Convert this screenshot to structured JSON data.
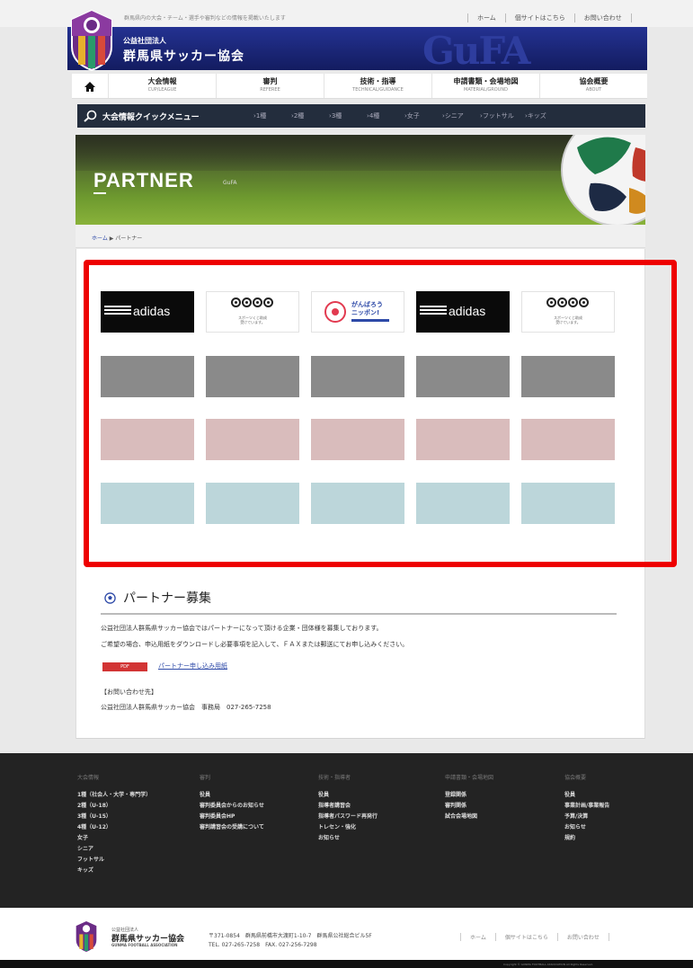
{
  "header": {
    "tagline": "群馬県内の大会・チーム・選手や審判などの情報を掲載いたします",
    "top_links": [
      "ホーム",
      "個サイトはこちら",
      "お問い合わせ"
    ],
    "assoc_sub": "公益社団法人",
    "assoc_title": "群馬県サッカー協会",
    "brand": "GuFA"
  },
  "nav": {
    "items": [
      {
        "label": "大会情報",
        "sub": "CUP/LEAGUE"
      },
      {
        "label": "審判",
        "sub": "REFEREE"
      },
      {
        "label": "技術・指導",
        "sub": "TECHNICAL/GUIDANCE"
      },
      {
        "label": "申請書類・会場地図",
        "sub": "MATERIAL/GROUND"
      },
      {
        "label": "協会概要",
        "sub": "ABOUT"
      }
    ]
  },
  "quick_menu": {
    "title": "大会情報クイックメニュー",
    "items": [
      "1種",
      "2種",
      "3種",
      "4種",
      "女子",
      "シニア",
      "フットサル",
      "キッズ"
    ]
  },
  "hero": {
    "title": "PARTNER",
    "sub": "GuFA"
  },
  "breadcrumb": {
    "home": "ホーム",
    "separator": " ▶ ",
    "current": "パートナー"
  },
  "partners": {
    "adidas_label": "adidas",
    "toto_caption": "スポーツくじ助成\n受けています。",
    "ganbaro_line1": "がんばろう",
    "ganbaro_line2": "ニッポン!",
    "colors": {
      "gray": "#8a8a8a",
      "pink": "#d9bcbc",
      "blue": "#bcd6da",
      "highlight": "#ee0000"
    }
  },
  "recruit": {
    "title": "パートナー募集",
    "p1": "公益社団法人群馬県サッカー協会ではパートナーになって頂ける企業・団体様を募集しております。",
    "p2": "ご希望の場合、申込用紙をダウンロードし必要事項を記入して、ＦＡＸまたは郵送にてお申し込みください。",
    "pdf_badge": "PDF",
    "pdf_link": "パートナー申し込み用紙",
    "contact_head": "【お問い合わせ先】",
    "contact_body": "公益社団法人群馬県サッカー協会　事務局　027-265-7258"
  },
  "footer": {
    "columns": [
      {
        "head": "大会情報",
        "items": [
          "1種（社会人・大学・専門学）",
          "2種（U-18）",
          "3種（U-15）",
          "4種（U-12）",
          "女子",
          "シニア",
          "フットサル",
          "キッズ"
        ]
      },
      {
        "head": "審判",
        "items": [
          "役員",
          "審判委員会からのお知らせ",
          "審判委員会HP",
          "審判講習会の受講について"
        ]
      },
      {
        "head": "技術・指導者",
        "items": [
          "役員",
          "指導者講習会",
          "指導者パスワード再発行",
          "トレセン・強化",
          "お知らせ"
        ]
      },
      {
        "head": "申請書類・会場地図",
        "items": [
          "登録関係",
          "審判関係",
          "試合会場地図"
        ]
      },
      {
        "head": "協会概要",
        "items": [
          "役員",
          "事業計画/事業報告",
          "予算/決算",
          "お知らせ",
          "規約"
        ]
      }
    ]
  },
  "bottom": {
    "assoc_sub": "公益社団法人",
    "assoc_name": "群馬県サッカー協会",
    "assoc_en": "GUNMA FOOTBALL ASSOCIATION",
    "address": "〒371-0854　群馬県前橋市大渡町1-10-7　群馬県公社総合ビル5F",
    "tel": "TEL. 027-265-7258　FAX. 027-256-7298",
    "links": [
      "ホーム",
      "個サイトはこちら",
      "お問い合わせ"
    ],
    "copyright": "Copyright © GUNMA FOOTBALL ASSOCIATION All Rights Reserved."
  }
}
